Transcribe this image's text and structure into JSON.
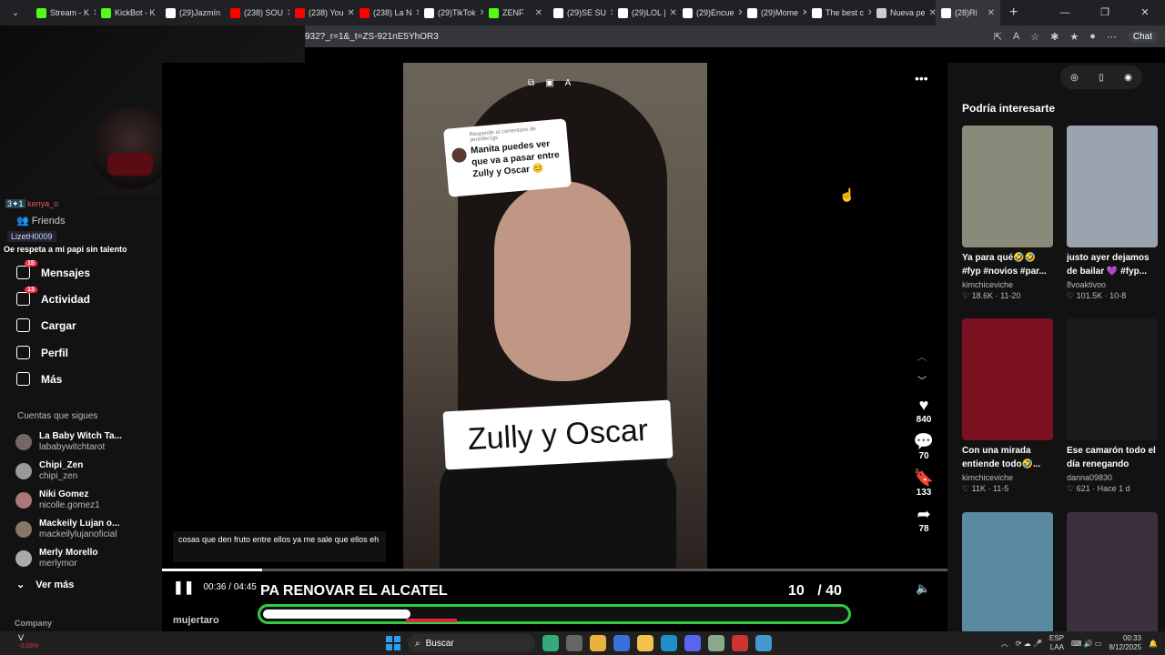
{
  "browser": {
    "tabs": [
      {
        "label": "Stream - K",
        "color": "#53fc18"
      },
      {
        "label": "KickBot - K",
        "color": "#53fc18"
      },
      {
        "label": "(29)Jazmín",
        "color": "#ffffff"
      },
      {
        "label": "(238) SOU",
        "color": "#ff0000"
      },
      {
        "label": "(238) You",
        "color": "#ff0000"
      },
      {
        "label": "(238) La N",
        "color": "#ff0000"
      },
      {
        "label": "(29)TikTok",
        "color": "#ffffff"
      },
      {
        "label": "ZENF",
        "color": "#53fc18"
      },
      {
        "label": "(29)SE SU",
        "color": "#ffffff"
      },
      {
        "label": "(29)LOL | ",
        "color": "#ffffff"
      },
      {
        "label": "(29)Encue",
        "color": "#ffffff"
      },
      {
        "label": "(29)Mome",
        "color": "#ffffff"
      },
      {
        "label": "The best c",
        "color": "#ffffff"
      },
      {
        "label": "Nueva pe",
        "color": "#cccccc"
      },
      {
        "label": "(28)Ri",
        "color": "#ffffff"
      }
    ],
    "url": "932?_r=1&_t=ZS-921nE5YhOR3",
    "chat_label": "Chat"
  },
  "stream_overlay": {
    "chat_user1": "kenya_o",
    "chat_label_friends": "Friends",
    "chat_user2": "LizetH0009",
    "chat_message2": "Oe respeta a mi papi sin talento"
  },
  "sidebar": {
    "items": [
      {
        "label": "Mensajes",
        "badge": "15",
        "icon": "paper-plane-icon"
      },
      {
        "label": "Actividad",
        "badge": "13",
        "icon": "inbox-icon"
      },
      {
        "label": "Cargar",
        "badge": "",
        "icon": "plus-square-icon"
      },
      {
        "label": "Perfil",
        "badge": "",
        "icon": "user-icon"
      },
      {
        "label": "Más",
        "badge": "",
        "icon": "more-icon"
      }
    ],
    "following_title": "Cuentas que sigues",
    "accounts": [
      {
        "name": "La Baby Witch Ta...",
        "handle": "lababywitchtarot"
      },
      {
        "name": "Chipi_Zen",
        "handle": "chipi_zen"
      },
      {
        "name": "Niki Gomez",
        "handle": "nicolle.gomez1"
      },
      {
        "name": "Mackeily Lujan o...",
        "handle": "mackeilylujanoficial"
      },
      {
        "name": "Merly Morello",
        "handle": "merlymor"
      }
    ],
    "see_more": "Ver más",
    "company": "Company"
  },
  "video": {
    "reply_sub": "Responde al comentario de yennifer1gs",
    "reply_text": "Manita puedes ver que va a pasar entre Zully y Oscar 😊",
    "sticker_text": "Zully y Oscar",
    "caption": "cosas que den fruto entre ellos ya me sale que ellos eh",
    "time": "00:36 / 04:45",
    "progress": 0.127,
    "likes": "840",
    "comments": "70",
    "saves": "133",
    "shares": "78",
    "author": "mujertaro"
  },
  "stream": {
    "title": "PA RENOVAR EL ALCATEL",
    "count_current": "10",
    "count_total": "/ 40",
    "goal_progress": 0.25
  },
  "recommended": {
    "title": "Podría interesarte",
    "cards": [
      {
        "title": "Ya para qué🤣🤣 #fyp #novios #par...",
        "user": "kimchiceviche",
        "stats": "♡ 18.6K · 11-20",
        "color": "#8a8a7a"
      },
      {
        "title": "justo ayer dejamos de bailar 💜 #fyp...",
        "user": "8voaktivoo",
        "stats": "♡ 101.5K · 10-8",
        "color": "#9aa4b0"
      },
      {
        "title": "Con una mirada entiende todo🤣...",
        "user": "kimchiceviche",
        "stats": "♡ 11K · 11-5",
        "color": "#7a1020"
      },
      {
        "title": "Ese camarón todo el día renegando Pero...",
        "user": "danna09830",
        "stats": "♡ 621 · Hace 1 d",
        "color": "#1a1a1a"
      },
      {
        "title": "",
        "user": "",
        "stats": "",
        "color": "#5a8aa0"
      },
      {
        "title": "",
        "user": "",
        "stats": "",
        "color": "#3a3040"
      }
    ]
  },
  "taskbar": {
    "stock": "V",
    "stock_pct": "-3.03%",
    "search": "Buscar",
    "lang": "ESP",
    "lang2": "LAA",
    "time": "00:33",
    "date": "8/12/2025"
  }
}
